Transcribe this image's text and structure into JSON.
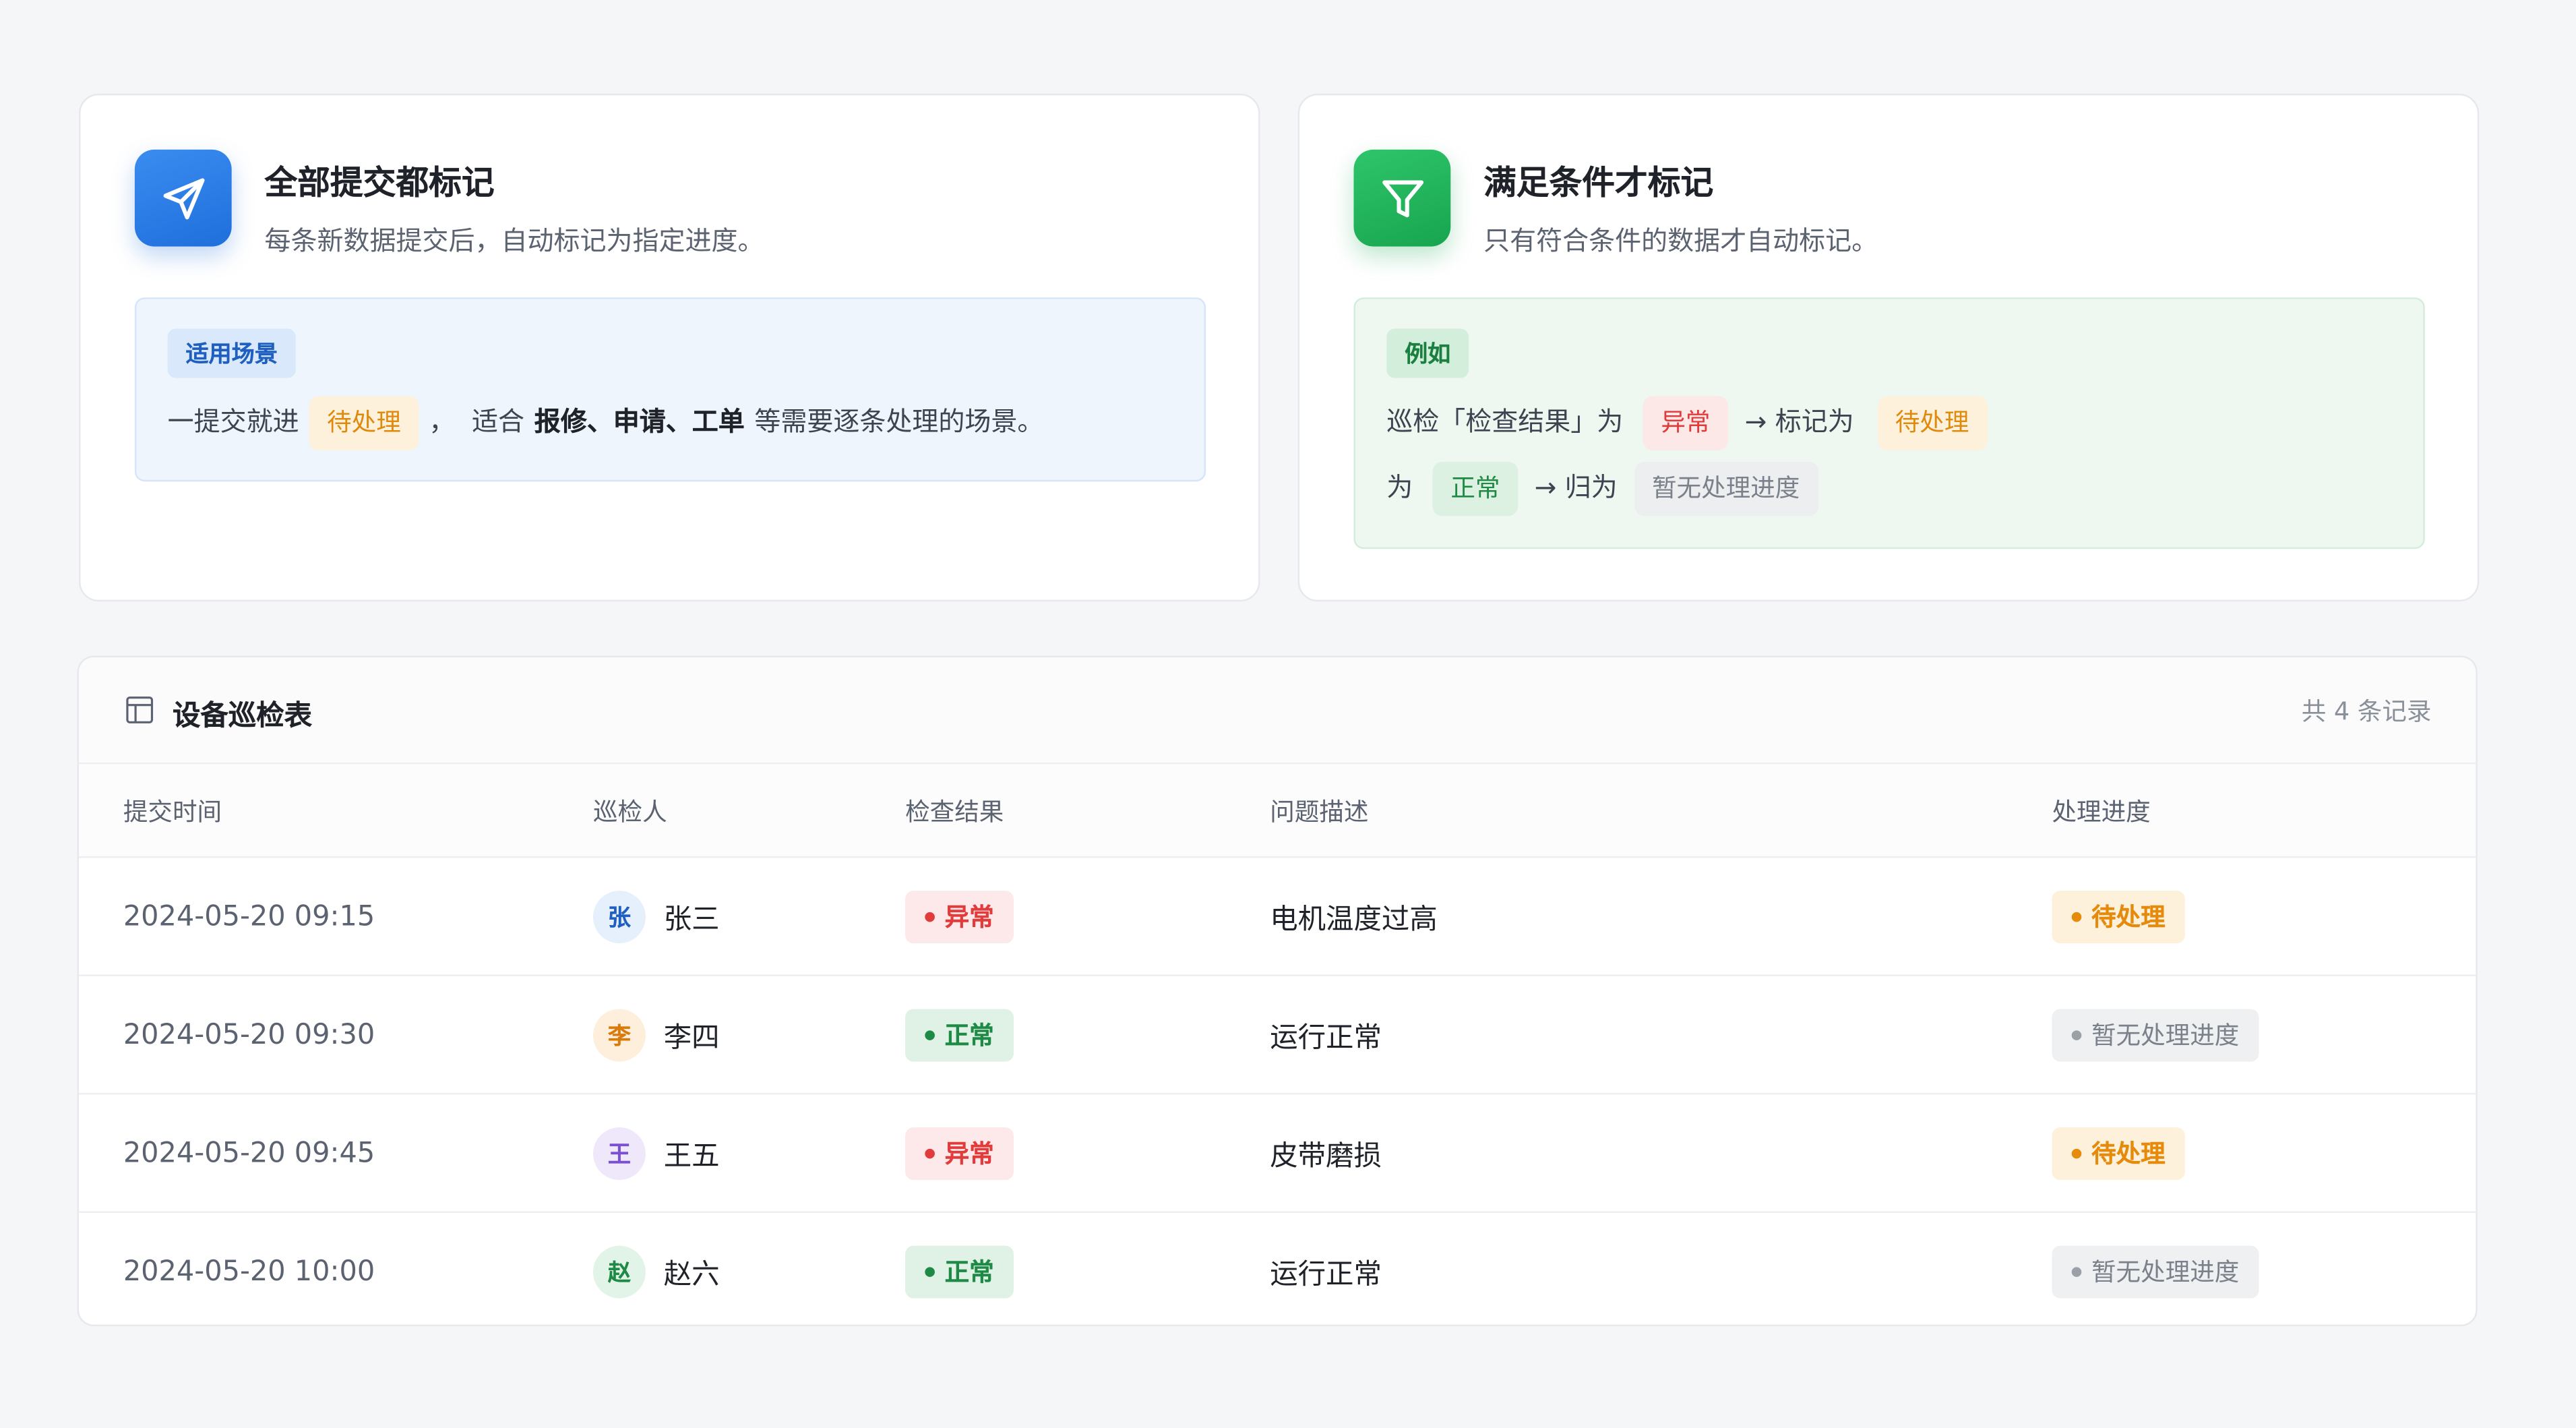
{
  "cards": {
    "all": {
      "title": "全部提交都标记",
      "desc": "每条新数据提交后，自动标记为指定进度。",
      "tag": "适用场景",
      "line_prefix": "一提交就进",
      "pill": "待处理",
      "line_mid": "，  适合",
      "bold": "报修、申请、工单",
      "line_suffix": "等需要逐条处理的场景。"
    },
    "cond": {
      "title": "满足条件才标记",
      "desc": "只有符合条件的数据才自动标记。",
      "tag": "例如",
      "l1_prefix": "巡检「检查结果」为",
      "l1_pill1": "异常",
      "l1_mid": "→ 标记为",
      "l1_pill2": "待处理",
      "l2_prefix": "为",
      "l2_pill1": "正常",
      "l2_mid": "→ 归为",
      "l2_pill2": "暂无处理进度"
    }
  },
  "table": {
    "title": "设备巡检表",
    "count": "共 4 条记录",
    "columns": [
      "提交时间",
      "巡检人",
      "检查结果",
      "问题描述",
      "处理进度"
    ],
    "rows": [
      {
        "time": "2024-05-20 09:15",
        "avatar": "张",
        "name": "张三",
        "result": "异常",
        "desc": "电机温度过高",
        "progress": "待处理"
      },
      {
        "time": "2024-05-20 09:30",
        "avatar": "李",
        "name": "李四",
        "result": "正常",
        "desc": "运行正常",
        "progress": "暂无处理进度"
      },
      {
        "time": "2024-05-20 09:45",
        "avatar": "王",
        "name": "王五",
        "result": "异常",
        "desc": "皮带磨损",
        "progress": "待处理"
      },
      {
        "time": "2024-05-20 10:00",
        "avatar": "赵",
        "name": "赵六",
        "result": "正常",
        "desc": "运行正常",
        "progress": "暂无处理进度"
      }
    ]
  },
  "colors": {
    "blue_accent": "#1f6fdc",
    "green_accent": "#17a54f",
    "abnormal": "#e23b3b",
    "normal": "#1e8a45",
    "pending": "#e58a0a",
    "none": "#7b818b"
  }
}
